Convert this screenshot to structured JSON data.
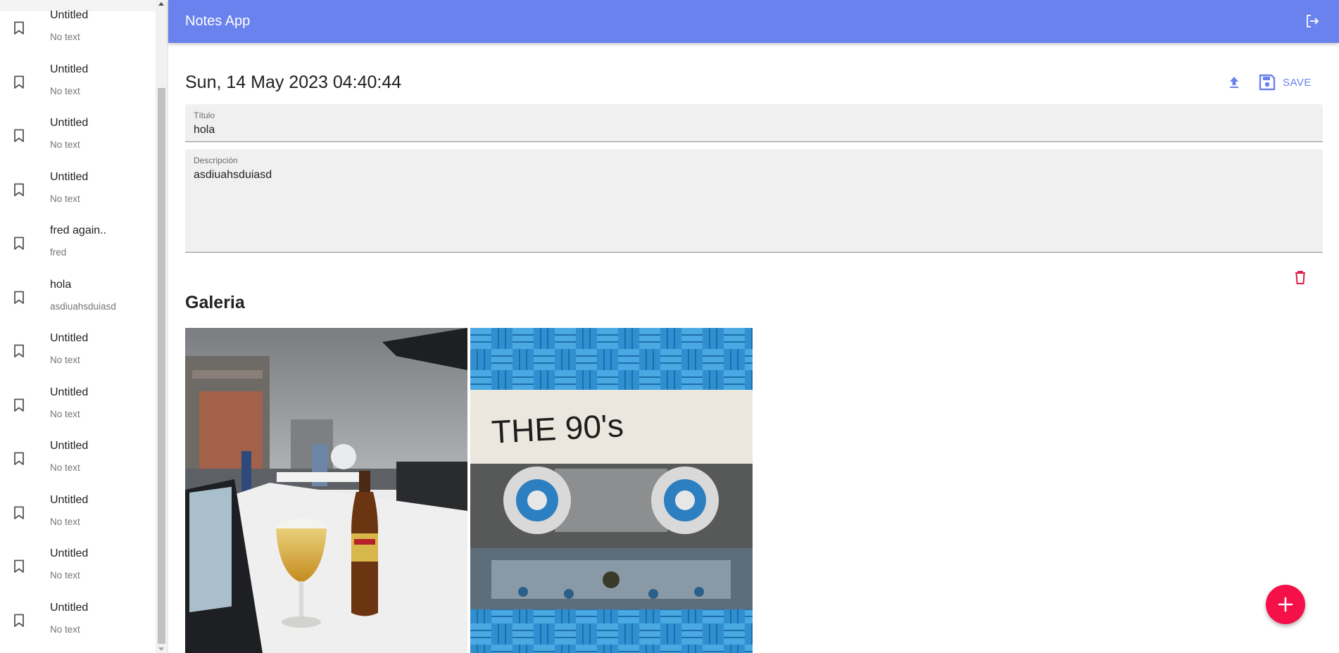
{
  "app": {
    "title": "Notes App",
    "accent_color": "#6a82ee",
    "fab_color": "#f5104a",
    "delete_color": "#e01b4a"
  },
  "sidebar": {
    "notes": [
      {
        "title": "Untitled",
        "subtitle": "No text",
        "icon": "bookmark-outline-icon"
      },
      {
        "title": "Untitled",
        "subtitle": "No text",
        "icon": "bookmark-outline-icon"
      },
      {
        "title": "Untitled",
        "subtitle": "No text",
        "icon": "bookmark-outline-icon"
      },
      {
        "title": "Untitled",
        "subtitle": "No text",
        "icon": "bookmark-outline-icon"
      },
      {
        "title": "fred again..",
        "subtitle": "fred",
        "icon": "bookmark-outline-icon"
      },
      {
        "title": "hola",
        "subtitle": "asdiuahsduiasd",
        "icon": "bookmark-outline-icon"
      },
      {
        "title": "Untitled",
        "subtitle": "No text",
        "icon": "bookmark-outline-icon"
      },
      {
        "title": "Untitled",
        "subtitle": "No text",
        "icon": "bookmark-outline-icon"
      },
      {
        "title": "Untitled",
        "subtitle": "No text",
        "icon": "bookmark-outline-icon"
      },
      {
        "title": "Untitled",
        "subtitle": "No text",
        "icon": "bookmark-outline-icon"
      },
      {
        "title": "Untitled",
        "subtitle": "No text",
        "icon": "bookmark-outline-icon"
      },
      {
        "title": "Untitled",
        "subtitle": "No text",
        "icon": "bookmark-outline-icon"
      }
    ]
  },
  "editor": {
    "date": "Sun, 14 May 2023 04:40:44",
    "upload_icon": "upload-icon",
    "save_label": "SAVE",
    "save_icon": "floppy-disk-icon",
    "title_field": {
      "label": "Título",
      "value": "hola"
    },
    "description_field": {
      "label": "Descripción",
      "value": "asdiuahsduiasd"
    },
    "delete_icon": "trash-icon"
  },
  "gallery": {
    "title": "Galeria",
    "images": [
      {
        "subject": "rooftop-terrace-beer-and-laptop"
      },
      {
        "subject": "cassette-tape-the-90s"
      }
    ],
    "cassette_label": "THE 90's"
  },
  "fab": {
    "icon": "plus-icon"
  }
}
